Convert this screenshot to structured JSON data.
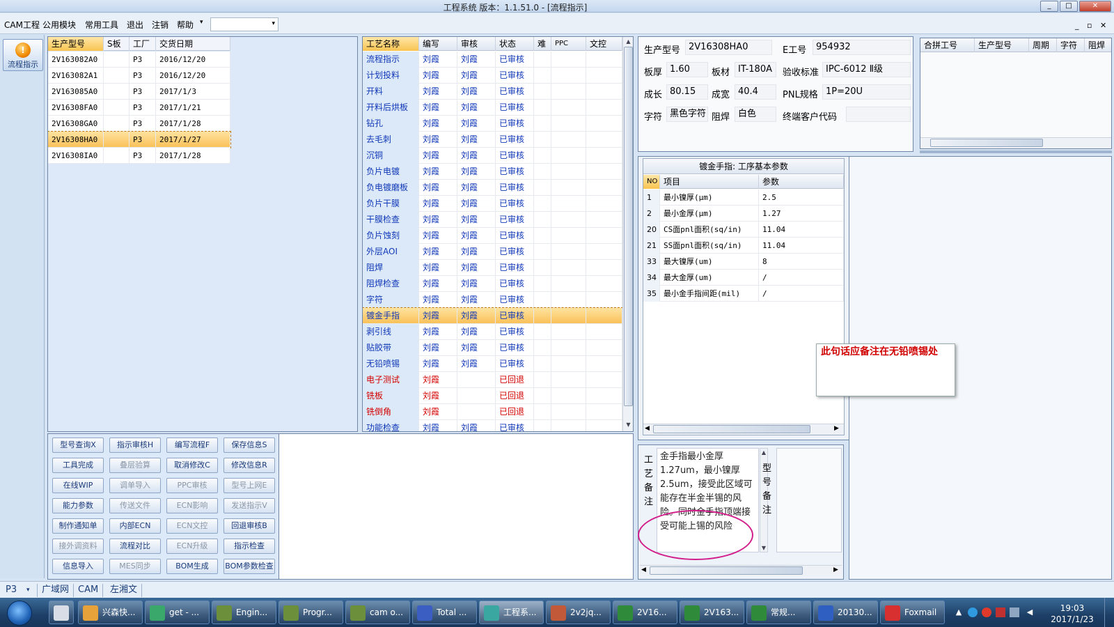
{
  "window": {
    "title": "工程系统   版本：1.1.51.0 - [流程指示]",
    "minimize": "_",
    "maximize": "□",
    "close": "✕"
  },
  "menu": {
    "items": [
      "CAM工程",
      "公用模块",
      "常用工具",
      "退出",
      "注销",
      "帮助"
    ],
    "help_arrow": "▾",
    "combo_value": "",
    "combo_arrow": "▾",
    "mdi_min": "_",
    "mdi_restore": "▫",
    "mdi_close": "✕"
  },
  "sidebar": {
    "flow_button": "流程指示"
  },
  "models_table": {
    "columns": [
      "生产型号",
      "S板",
      "工厂",
      "交货日期"
    ],
    "rows": [
      [
        "2V163082A0",
        "",
        "P3",
        "2016/12/20"
      ],
      [
        "2V163082A1",
        "",
        "P3",
        "2016/12/20"
      ],
      [
        "2V163085A0",
        "",
        "P3",
        "2017/1/3"
      ],
      [
        "2V16308FA0",
        "",
        "P3",
        "2017/1/21"
      ],
      [
        "2V16308GA0",
        "",
        "P3",
        "2017/1/28"
      ],
      [
        "2V16308HA0",
        "",
        "P3",
        "2017/1/27"
      ],
      [
        "2V16308IA0",
        "",
        "P3",
        "2017/1/28"
      ]
    ],
    "selected_index": 5
  },
  "process_table": {
    "columns": [
      "工艺名称",
      "编写",
      "审核",
      "状态",
      "难",
      "PPC",
      "文控"
    ],
    "rows": [
      [
        "流程指示",
        "刘霞",
        "刘霞",
        "已审核",
        "",
        "",
        "",
        "ok"
      ],
      [
        "计划投料",
        "刘霞",
        "刘霞",
        "已审核",
        "",
        "",
        "",
        "ok"
      ],
      [
        "开料",
        "刘霞",
        "刘霞",
        "已审核",
        "",
        "",
        "",
        "ok"
      ],
      [
        "开料后烘板",
        "刘霞",
        "刘霞",
        "已审核",
        "",
        "",
        "",
        "ok"
      ],
      [
        "钻孔",
        "刘霞",
        "刘霞",
        "已审核",
        "",
        "",
        "",
        "ok"
      ],
      [
        "去毛刺",
        "刘霞",
        "刘霞",
        "已审核",
        "",
        "",
        "",
        "ok"
      ],
      [
        "沉铜",
        "刘霞",
        "刘霞",
        "已审核",
        "",
        "",
        "",
        "ok"
      ],
      [
        "负片电镀",
        "刘霞",
        "刘霞",
        "已审核",
        "",
        "",
        "",
        "ok"
      ],
      [
        "负电镀磨板",
        "刘霞",
        "刘霞",
        "已审核",
        "",
        "",
        "",
        "ok"
      ],
      [
        "负片干膜",
        "刘霞",
        "刘霞",
        "已审核",
        "",
        "",
        "",
        "ok"
      ],
      [
        "干膜检查",
        "刘霞",
        "刘霞",
        "已审核",
        "",
        "",
        "",
        "ok"
      ],
      [
        "负片蚀刻",
        "刘霞",
        "刘霞",
        "已审核",
        "",
        "",
        "",
        "ok"
      ],
      [
        "外层AOI",
        "刘霞",
        "刘霞",
        "已审核",
        "",
        "",
        "",
        "ok"
      ],
      [
        "阻焊",
        "刘霞",
        "刘霞",
        "已审核",
        "",
        "",
        "",
        "ok"
      ],
      [
        "阻焊检查",
        "刘霞",
        "刘霞",
        "已审核",
        "",
        "",
        "",
        "ok"
      ],
      [
        "字符",
        "刘霞",
        "刘霞",
        "已审核",
        "",
        "",
        "",
        "ok"
      ],
      [
        "镀金手指",
        "刘霞",
        "刘霞",
        "已审核",
        "",
        "",
        "",
        "sel"
      ],
      [
        "剥引线",
        "刘霞",
        "刘霞",
        "已审核",
        "",
        "",
        "",
        "ok"
      ],
      [
        "贴胶带",
        "刘霞",
        "刘霞",
        "已审核",
        "",
        "",
        "",
        "ok"
      ],
      [
        "无铅喷锡",
        "刘霞",
        "刘霞",
        "已审核",
        "",
        "",
        "",
        "ok"
      ],
      [
        "电子测试",
        "刘霞",
        "",
        "已回退",
        "",
        "",
        "",
        "back"
      ],
      [
        "铣板",
        "刘霞",
        "",
        "已回退",
        "",
        "",
        "",
        "back"
      ],
      [
        "铣倒角",
        "刘霞",
        "",
        "已回退",
        "",
        "",
        "",
        "back"
      ],
      [
        "功能检查",
        "刘霞",
        "刘霞",
        "已审核",
        "",
        "",
        "",
        "ok"
      ]
    ]
  },
  "info": {
    "model_label": "生产型号",
    "model_value": "2V16308HA0",
    "e_label": "E工号",
    "e_value": "954932",
    "thick_label": "板厚",
    "thick_value": "1.60",
    "material_label": "板材",
    "material_value": "IT-180A",
    "std_label": "验收标准",
    "std_value": "IPC-6012 Ⅱ级",
    "len_label": "成长",
    "len_value": "80.15",
    "wid_label": "成宽",
    "wid_value": "40.4",
    "pnl_label": "PNL规格",
    "pnl_value": "1P=20U",
    "char_label": "字符",
    "char_value": "黑色字符",
    "mask_label": "阻焊",
    "mask_value": "白色",
    "cust_label": "终端客户代码",
    "cust_value": ""
  },
  "merge_table": {
    "columns": [
      "合拼工号",
      "生产型号",
      "周期",
      "字符",
      "阻焊"
    ]
  },
  "params": {
    "title": "镀金手指: 工序基本参数",
    "columns": [
      "NO",
      "项目",
      "参数"
    ],
    "rows": [
      [
        "1",
        "最小镍厚(μm)",
        "2.5"
      ],
      [
        "2",
        "最小金厚(μm)",
        "1.27"
      ],
      [
        "20",
        "CS面pnl面积(sq/in)",
        "11.04"
      ],
      [
        "21",
        "SS面pnl面积(sq/in)",
        "11.04"
      ],
      [
        "33",
        "最大镍厚(um)",
        "8"
      ],
      [
        "34",
        "最大金厚(um)",
        "/"
      ],
      [
        "35",
        "最小金手指间距(mil)",
        "/"
      ]
    ]
  },
  "annotation": {
    "note": "此句话应备注在无铅喷锡处"
  },
  "remarks": {
    "process_label": "工艺备注",
    "process_text": "金手指最小金厚1.27um，最小镍厚2.5um，接受此区域可能存在半金半锡的风险。同时金手指顶端接受可能上锡的风险",
    "model_label": "型号备注",
    "model_text": ""
  },
  "buttons": [
    [
      "型号查询X",
      "指示审核H",
      "编写流程F",
      "保存信息S"
    ],
    [
      "工具完成",
      "叠层验算",
      "取消修改C",
      "修改信息R"
    ],
    [
      "在线WIP",
      "调单导入",
      "PPC审核",
      "型号上网E"
    ],
    [
      "能力参数",
      "传送文件",
      "ECN影响",
      "发送指示V"
    ],
    [
      "制作通知单",
      "内部ECN",
      "ECN文控",
      "回退审核B"
    ],
    [
      "接外调资料",
      "流程对比",
      "ECN升级",
      "指示检查"
    ],
    [
      "信息导入",
      "MES同步",
      "BOM生成",
      "BOM参数检查"
    ]
  ],
  "buttons_disabled": [
    [
      1,
      1
    ],
    [
      2,
      1
    ],
    [
      2,
      2
    ],
    [
      2,
      3
    ],
    [
      3,
      1
    ],
    [
      3,
      2
    ],
    [
      3,
      3
    ],
    [
      4,
      2
    ],
    [
      5,
      0
    ],
    [
      5,
      2
    ],
    [
      6,
      1
    ]
  ],
  "status": {
    "factory": "P3",
    "factory_arrow": "▾",
    "tabs": [
      "广域网",
      "CAM",
      "左湘文"
    ]
  },
  "taskbar": {
    "items": [
      {
        "label": "兴森快...",
        "color": "#e8a23a"
      },
      {
        "label": "get - ...",
        "color": "#3aa86b"
      },
      {
        "label": "Engin...",
        "color": "#6b8f3a"
      },
      {
        "label": "Progr...",
        "color": "#6b8f3a"
      },
      {
        "label": "cam o...",
        "color": "#6b8f3a"
      },
      {
        "label": "Total ...",
        "color": "#3a5ec2"
      },
      {
        "label": "工程系...",
        "color": "#3aa8a0"
      },
      {
        "label": "2v2jq...",
        "color": "#c25a3a"
      },
      {
        "label": "2V16...",
        "color": "#2f8a3a"
      },
      {
        "label": "2V163...",
        "color": "#2f8a3a"
      },
      {
        "label": "常规...",
        "color": "#2f8a3a"
      },
      {
        "label": "20130...",
        "color": "#2f5fc0"
      },
      {
        "label": "Foxmail",
        "color": "#d83030"
      }
    ],
    "time": "19:03",
    "date": "2017/1/23"
  }
}
